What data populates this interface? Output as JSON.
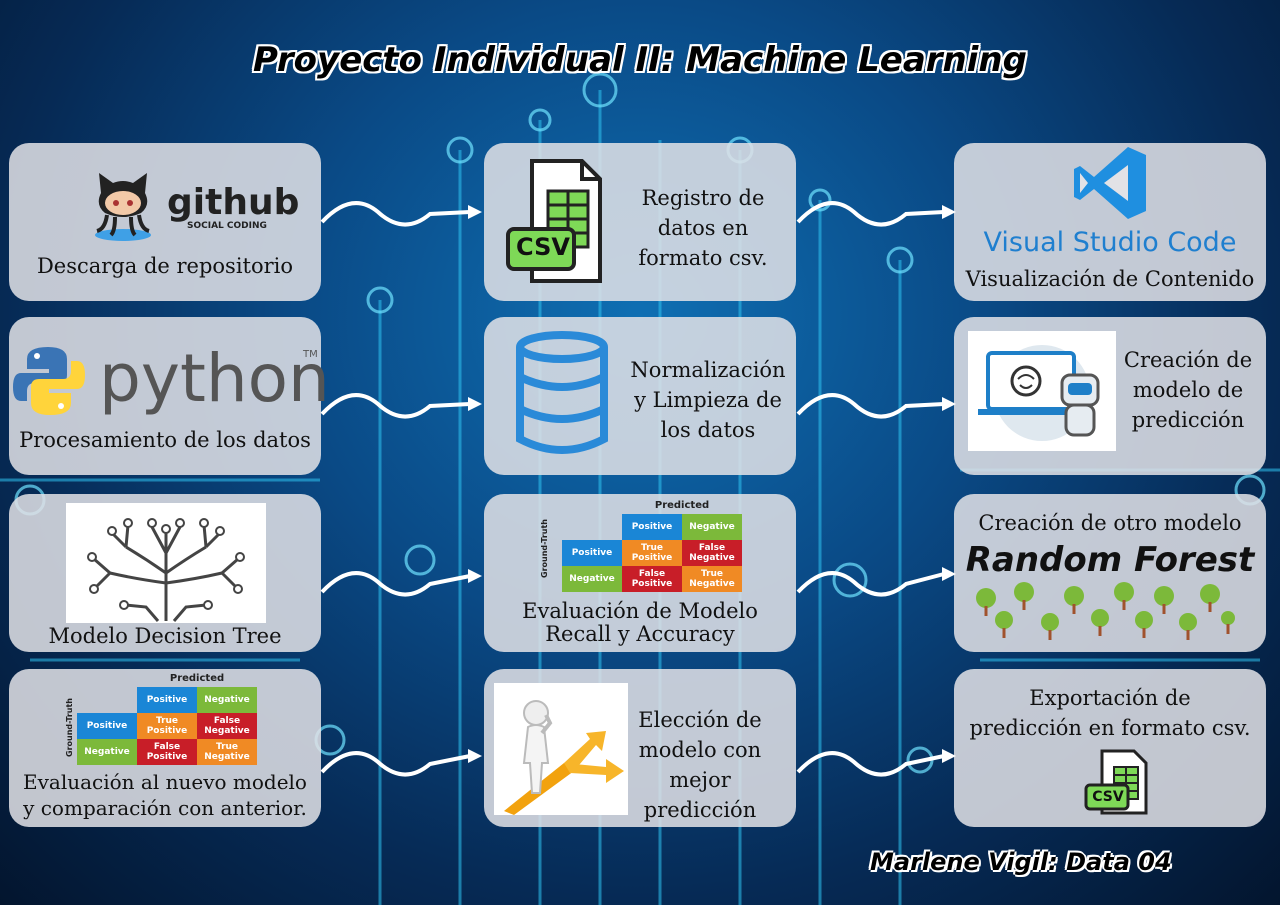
{
  "title": "Proyecto Individual II: Machine Learning",
  "author": "Marlene Vigil: Data 04",
  "cards": {
    "github": {
      "logo_text": "github",
      "logo_sub": "SOCIAL CODING",
      "label": "Descarga de repositorio",
      "icon": "octocat-icon"
    },
    "csv_registro": {
      "badge": "CSV",
      "label": [
        "Registro de",
        "datos en",
        "formato csv."
      ],
      "icon": "csv-file-icon"
    },
    "vscode": {
      "logo_text": "Visual Studio Code",
      "label": "Visualización de Contenido",
      "icon": "vscode-icon"
    },
    "python": {
      "logo_text": "python",
      "tm": "TM",
      "label": "Procesamiento de los datos",
      "icon": "python-icon"
    },
    "normalizacion": {
      "label": [
        "Normalización",
        "y Limpieza de",
        "los datos"
      ],
      "icon": "database-icon"
    },
    "prediccion": {
      "label": [
        "Creación de",
        "modelo de",
        "predicción"
      ],
      "icon": "ai-laptop-icon"
    },
    "decision_tree": {
      "label": "Modelo Decision Tree",
      "icon": "tree-icon"
    },
    "evaluacion": {
      "label": [
        "Evaluación de Modelo",
        "Recall y Accuracy"
      ],
      "icon": "confusion-matrix-icon"
    },
    "random_forest": {
      "heading": "Creación de otro modelo",
      "logo_text": "Random Forest",
      "icon": "forest-icon"
    },
    "evaluacion_nuevo": {
      "label": [
        "Evaluación al nuevo modelo",
        "y comparación con anterior."
      ],
      "icon": "confusion-matrix-icon"
    },
    "eleccion": {
      "label": [
        "Elección de",
        "modelo con",
        "mejor predicción"
      ],
      "icon": "crossroads-figure-icon"
    },
    "exportacion": {
      "label": [
        "Exportación de",
        "predicción en formato csv."
      ],
      "badge": "CSV",
      "icon": "csv-file-icon"
    }
  },
  "confusion_matrix": {
    "predicted": "Predicted",
    "ground_truth": "Ground-Truth",
    "positive": "Positive",
    "negative": "Negative",
    "tp": [
      "True",
      "Positive"
    ],
    "fn": [
      "False",
      "Negative"
    ],
    "fp": [
      "False",
      "Positive"
    ],
    "tn": [
      "True",
      "Negative"
    ]
  },
  "colors": {
    "card": "#e2e2e6",
    "accent_blue": "#1a86d6",
    "green": "#7cb93a",
    "orange": "#f08a24",
    "red": "#c81e28"
  }
}
